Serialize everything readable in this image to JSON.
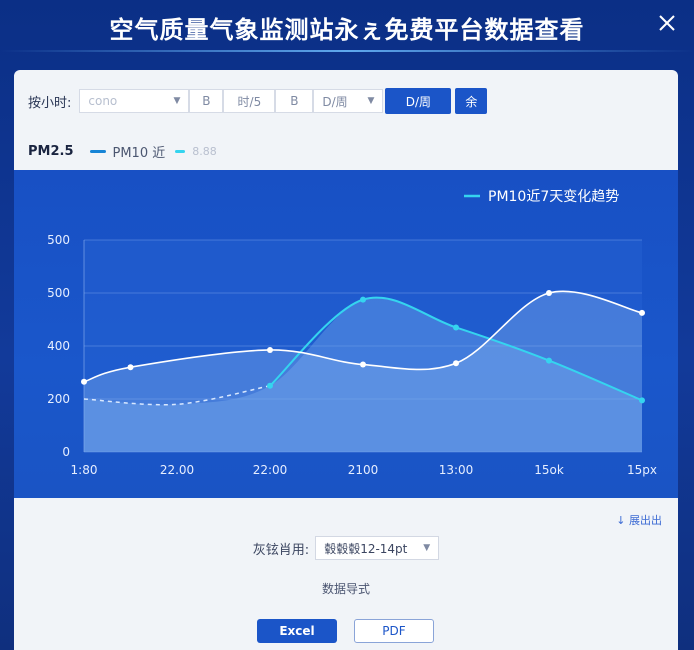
{
  "header": {
    "title": "空气质量气象监测站永ぇ免费平台数据查看"
  },
  "controls": {
    "label": "按小时:",
    "select_value": "cono",
    "seg1": "B",
    "seg2": "时/5",
    "seg3": "B",
    "week": "D/周",
    "day_button": "D/周",
    "small_button": "余"
  },
  "legend": {
    "pm25": "PM2.5",
    "pm10": "PM10 近",
    "third": "8.88"
  },
  "colors": {
    "accent": "#1b55c8",
    "pm10_line": "#1784d6",
    "trend_line": "#35d4ef"
  },
  "chart_data": {
    "type": "line",
    "title": "PM10近7天变化趋势",
    "categories": [
      "1:80",
      "22.00",
      "22:00",
      "2100",
      "13:00",
      "15ok",
      "15px"
    ],
    "yticks": [
      "0",
      "200",
      "400",
      "500",
      "500"
    ],
    "y_tick_values": [
      0,
      200,
      400,
      600,
      800
    ],
    "ylim": [
      0,
      800
    ],
    "grid": true,
    "legend_position": "top-right",
    "series": [
      {
        "name": "PM10近7天变化趋势",
        "x": [
          0,
          0.5,
          2,
          3,
          4,
          5,
          6
        ],
        "values": [
          265,
          320,
          385,
          330,
          335,
          600,
          525
        ]
      },
      {
        "x": [
          0,
          1,
          2,
          3,
          4,
          5,
          6
        ],
        "values": [
          200,
          180,
          250,
          575,
          470,
          345,
          195
        ]
      }
    ]
  },
  "bottom": {
    "expand_link": "↓ 展出出",
    "size_label": "灰铉肖用:",
    "size_value": "毂毂毂12-14pt",
    "export_label": "数据导式",
    "excel": "Excel",
    "pdf": "PDF"
  }
}
